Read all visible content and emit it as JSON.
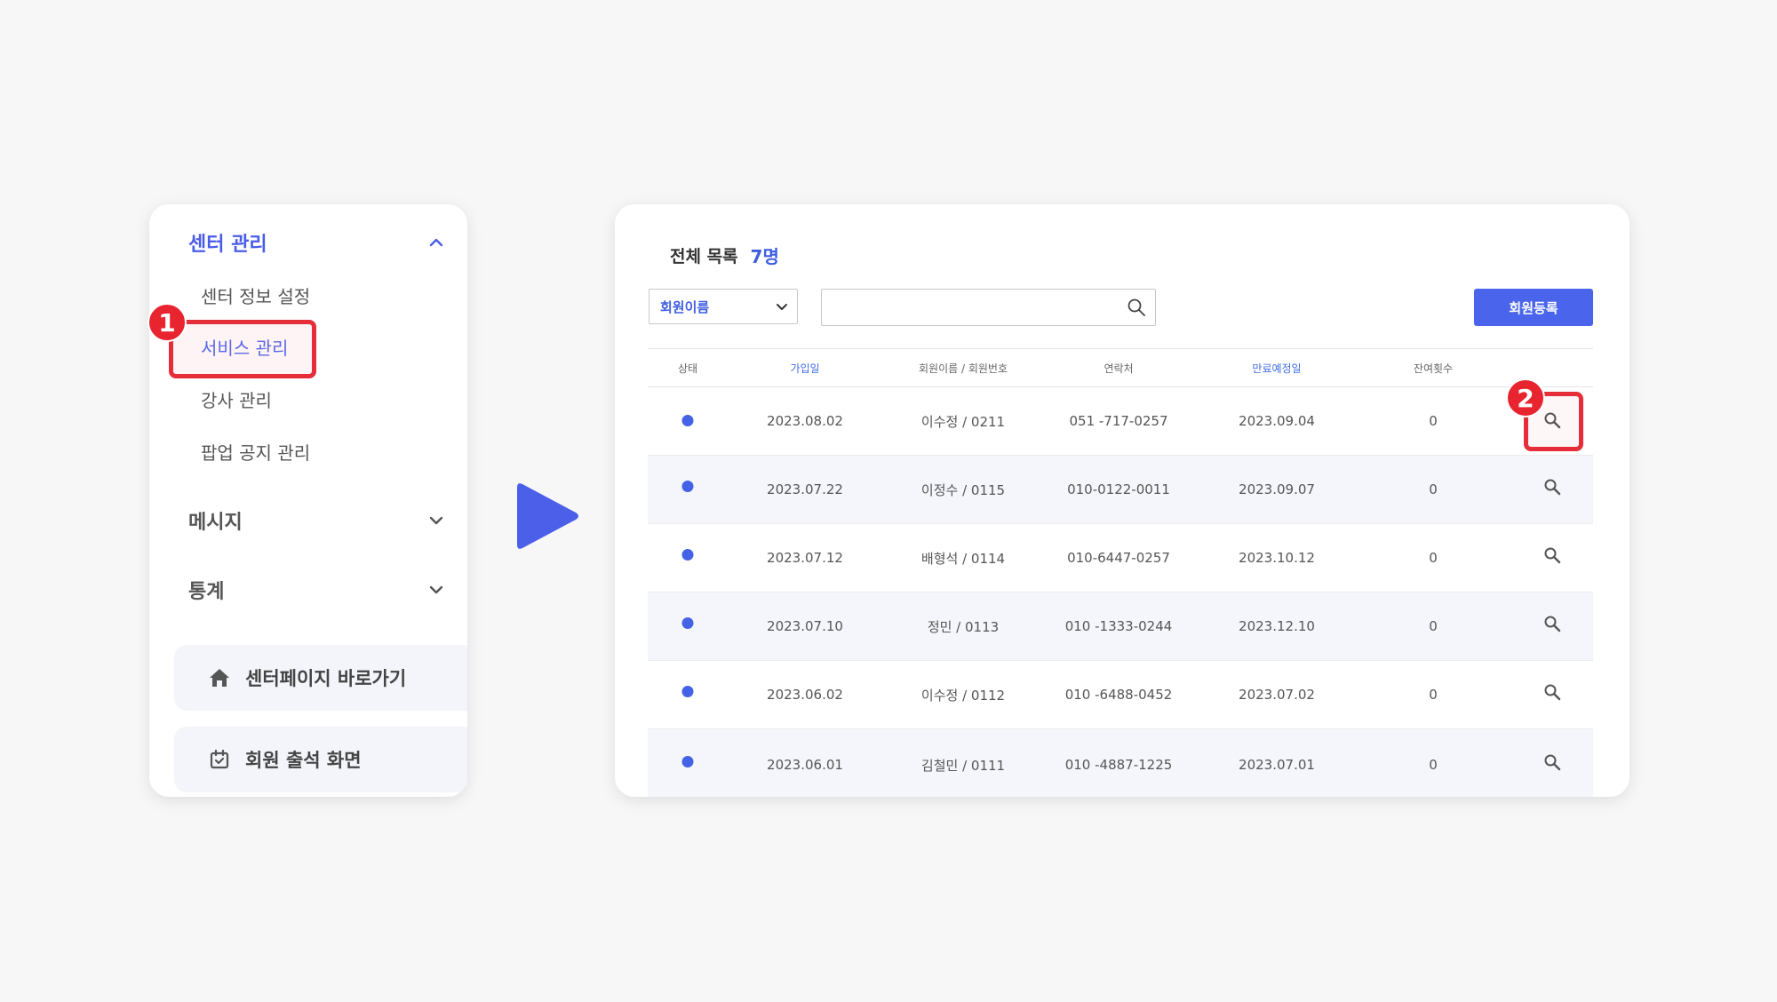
{
  "sidebar": {
    "sections": [
      {
        "label": "센터 관리",
        "expanded": true,
        "active": true
      },
      {
        "label": "메시지",
        "expanded": false
      },
      {
        "label": "통계",
        "expanded": false
      }
    ],
    "sub_items": [
      "센터 정보 설정",
      "서비스 관리",
      "강사 관리",
      "팝업 공지 관리"
    ],
    "active_sub_item": "서비스 관리",
    "shortcuts": [
      {
        "label": "센터페이지 바로가기",
        "icon": "home-icon"
      },
      {
        "label": "회원 출석 화면",
        "icon": "calendar-check-icon"
      }
    ]
  },
  "steps": [
    "1",
    "2"
  ],
  "list": {
    "title": "전체 목록",
    "count": "7명",
    "filter_selected": "회원이름",
    "search_value": "",
    "register_button": "회원등록"
  },
  "table": {
    "headers": [
      "상태",
      "가입일",
      "회원이름 / 회원번호",
      "연락처",
      "만료예정일",
      "잔여횟수"
    ],
    "highlighted_headers": [
      "가입일",
      "만료예정일"
    ],
    "rows": [
      {
        "join_date": "2023.08.02",
        "member": "이수정 / 0211",
        "phone": "051 -717-0257",
        "expiry": "2023.09.04",
        "remaining": "0"
      },
      {
        "join_date": "2023.07.22",
        "member": "이정수 / 0115",
        "phone": "010-0122-0011",
        "expiry": "2023.09.07",
        "remaining": "0"
      },
      {
        "join_date": "2023.07.12",
        "member": "배형석 / 0114",
        "phone": "010-6447-0257",
        "expiry": "2023.10.12",
        "remaining": "0"
      },
      {
        "join_date": "2023.07.10",
        "member": "정민 / 0113",
        "phone": "010 -1333-0244",
        "expiry": "2023.12.10",
        "remaining": "0"
      },
      {
        "join_date": "2023.06.02",
        "member": "이수정 / 0112",
        "phone": "010 -6488-0452",
        "expiry": "2023.07.02",
        "remaining": "0"
      },
      {
        "join_date": "2023.06.01",
        "member": "김철민 / 0111",
        "phone": "010 -4887-1225",
        "expiry": "2023.07.01",
        "remaining": "0"
      }
    ]
  },
  "colors": {
    "accent": "#4a65ec",
    "highlight": "#e52e3a",
    "status_dot": "#4462e6",
    "play_arrow": "#4b5fe8"
  }
}
